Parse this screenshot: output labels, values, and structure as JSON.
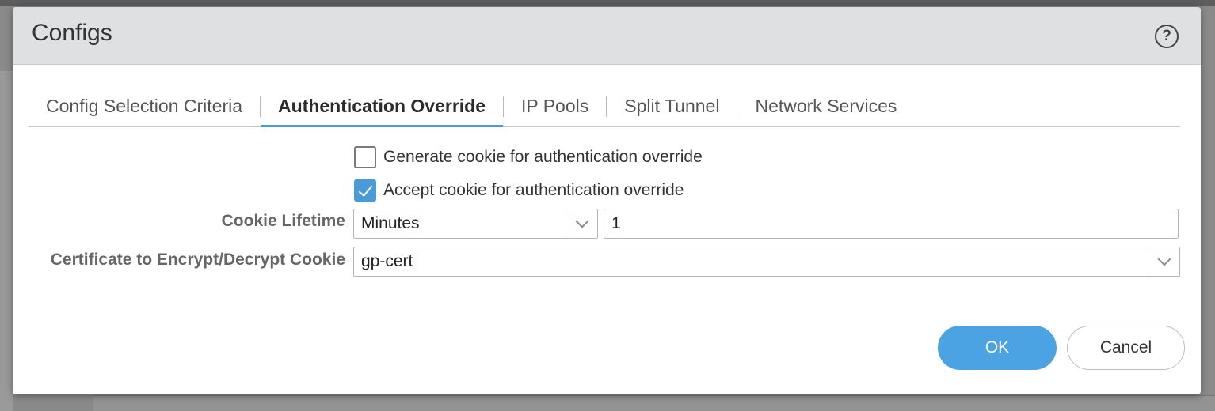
{
  "dialog": {
    "title": "Configs",
    "help_icon": "question-circle-icon"
  },
  "tabs": [
    {
      "label": "Config Selection Criteria",
      "active": false
    },
    {
      "label": "Authentication Override",
      "active": true
    },
    {
      "label": "IP Pools",
      "active": false
    },
    {
      "label": "Split Tunnel",
      "active": false
    },
    {
      "label": "Network Services",
      "active": false
    }
  ],
  "form": {
    "generate_cookie": {
      "label": "Generate cookie for authentication override",
      "checked": false
    },
    "accept_cookie": {
      "label": "Accept cookie for authentication override",
      "checked": true
    },
    "cookie_lifetime": {
      "label": "Cookie Lifetime",
      "unit": "Minutes",
      "value": "1"
    },
    "certificate": {
      "label": "Certificate to Encrypt/Decrypt Cookie",
      "value": "gp-cert"
    }
  },
  "buttons": {
    "ok": "OK",
    "cancel": "Cancel"
  },
  "colors": {
    "accent": "#4ba3e3",
    "header_bg": "#dfe0e2"
  }
}
